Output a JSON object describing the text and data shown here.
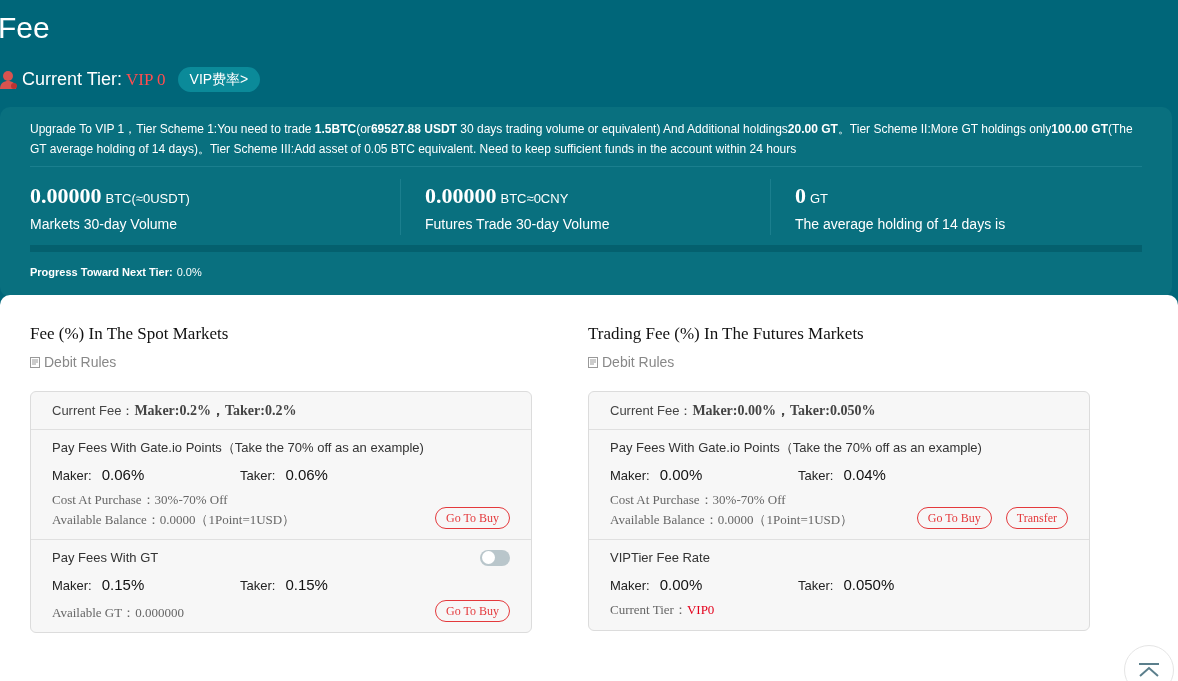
{
  "title": "Fee",
  "tier": {
    "label": "Current Tier:",
    "value": "VIP 0",
    "link": "VIP费率>"
  },
  "upgrade_note": "Upgrade To VIP 1，Tier Scheme 1:You need to trade **1.5BTC**(or**69527.88 USDT** 30 days trading volume or equivalent) And Additional holdings**20.00 GT**。Tier Scheme II:More GT holdings only**100.00 GT**(The GT average holding of 14 days)。Tier Scheme III:Add asset of 0.05 BTC equivalent. Need to keep sufficient funds in the account within 24 hours",
  "stats": [
    {
      "value": "0.00000",
      "unit": "BTC(≈0USDT)",
      "label": "Markets 30-day Volume"
    },
    {
      "value": "0.00000",
      "unit": "BTC≈0CNY",
      "label": "Futures Trade 30-day Volume"
    },
    {
      "value": "0",
      "unit": "GT",
      "label": "The average holding of 14 days is"
    }
  ],
  "progress": {
    "label": "Progress Toward Next Tier:",
    "value": "0.0%",
    "level": 0
  },
  "panels": [
    {
      "title": "Fee (%) In The Spot Markets",
      "debit_rules": "Debit Rules",
      "current_fee_label": "Current Fee：",
      "current_fee_value": "Maker:0.2%，Taker:0.2%",
      "sections": [
        {
          "heading": "Pay Fees With Gate.io Points（Take the 70% off as an example)",
          "maker_label": "Maker:",
          "maker": "0.06%",
          "taker_label": "Taker:",
          "taker": "0.06%",
          "lines": [
            {
              "label": "Cost At Purchase：",
              "value": "30%-70% Off",
              "highlight": false
            },
            {
              "label": "Available Balance：",
              "value": "0.0000（1Point=1USD）",
              "highlight": false
            }
          ],
          "buttons": [
            "Go To Buy"
          ]
        },
        {
          "heading": "Pay Fees With GT",
          "toggle": {
            "on": false
          },
          "maker_label": "Maker:",
          "maker": "0.15%",
          "taker_label": "Taker:",
          "taker": "0.15%",
          "lines": [
            {
              "label": "Available GT：",
              "value": "0.000000",
              "highlight": false
            }
          ],
          "buttons": [
            "Go To Buy"
          ]
        }
      ]
    },
    {
      "title": "Trading Fee (%) In The Futures Markets",
      "debit_rules": "Debit Rules",
      "current_fee_label": "Current Fee：",
      "current_fee_value": "Maker:0.00%，Taker:0.050%",
      "sections": [
        {
          "heading": "Pay Fees With Gate.io Points（Take the 70% off as an example)",
          "maker_label": "Maker:",
          "maker": "0.00%",
          "taker_label": "Taker:",
          "taker": "0.04%",
          "lines": [
            {
              "label": "Cost At Purchase：",
              "value": "30%-70% Off",
              "highlight": false
            },
            {
              "label": "Available Balance：",
              "value": "0.0000（1Point=1USD）",
              "highlight": false
            }
          ],
          "buttons": [
            "Go To Buy",
            "Transfer"
          ]
        },
        {
          "heading": "VIPTier Fee Rate",
          "maker_label": "Maker:",
          "maker": "0.00%",
          "taker_label": "Taker:",
          "taker": "0.050%",
          "lines": [
            {
              "label": "Current Tier：",
              "value": "VIP0",
              "highlight": true
            }
          ]
        }
      ]
    }
  ]
}
